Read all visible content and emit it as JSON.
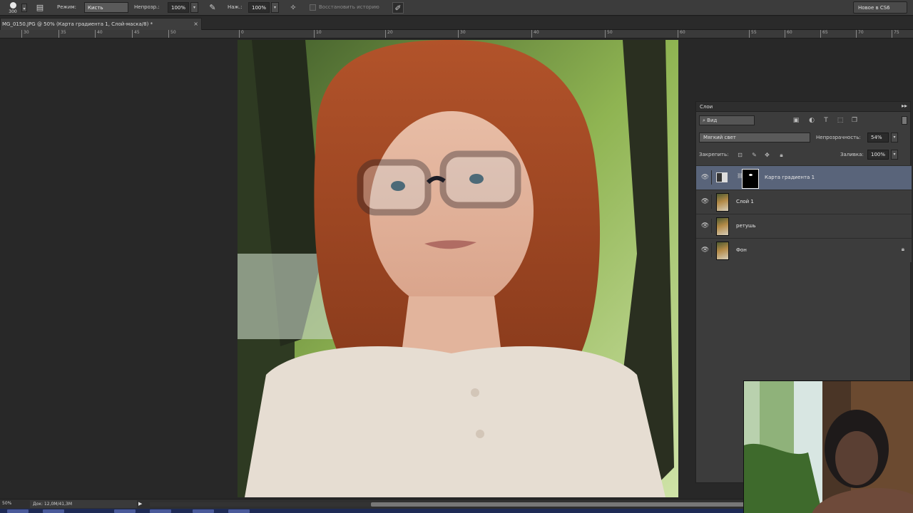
{
  "options_bar": {
    "brush_size": "300",
    "mode_label": "Режим:",
    "mode_value": "Кисть",
    "opacity_label": "Непрозр.:",
    "opacity_value": "100%",
    "flow_label": "Наж.:",
    "flow_value": "100%",
    "restore_history_label": "Восстановить историю",
    "workspace_button": "Новое в CS6"
  },
  "document_tab": {
    "title": "MG_0150.JPG @ 50% (Карта градиента 1, Слой-маска/8) *",
    "close": "×"
  },
  "rulers": {
    "h_ticks": [
      "30",
      "35",
      "40",
      "45",
      "50",
      "55",
      "60",
      "65",
      "70",
      "75",
      "80"
    ]
  },
  "layers_panel": {
    "title": "Слои",
    "menu_glyph": "▸▸",
    "filter_label": "Вид",
    "blend_mode": "Мягкий свет",
    "opacity_label": "Непрозрачность:",
    "opacity_value": "54%",
    "lock_label": "Закрепить:",
    "fill_label": "Заливка:",
    "fill_value": "100%",
    "layers": [
      {
        "name": "Карта градиента 1",
        "kind": "adjustment",
        "active": true
      },
      {
        "name": "Слой 1",
        "kind": "image",
        "active": false
      },
      {
        "name": "ретушь",
        "kind": "image",
        "active": false
      },
      {
        "name": "Фон",
        "kind": "image",
        "active": false,
        "locked": true
      }
    ]
  },
  "status_bar": {
    "zoom": "50%",
    "doc_info": "Док: 12,0M/41,3M",
    "arrow": "▶"
  }
}
